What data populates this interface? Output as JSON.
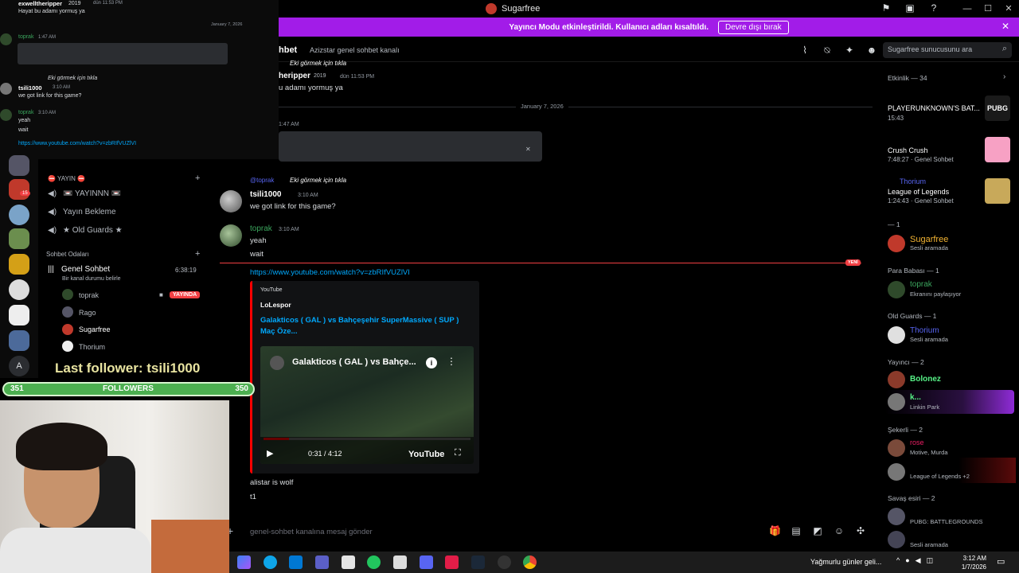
{
  "window": {
    "title": "Sugarfree"
  },
  "banner": {
    "message": "Yayıncı Modu etkinleştirildi. Kullanıcı adları kısaltıldı.",
    "button": "Devre dışı bırak"
  },
  "channel": {
    "name": "hbet",
    "topic": "Azizstar genel sohbet kanalı",
    "search_placeholder": "Sugarfree sunucusunu ara"
  },
  "chat": {
    "top_msg": {
      "title": "Eki görmek için tıkla",
      "name": "heripper",
      "badge": "2019",
      "time": "dün 11:53 PM",
      "text": "u adamı yormuş ya"
    },
    "date": "January 7, 2026",
    "msg2_time": "1:47 AM",
    "reply_ref": {
      "who": "@toprak",
      "text": "Eki görmek için tıkla"
    },
    "msg3": {
      "name": "tsili1000",
      "time": "3:10 AM",
      "text": "we got link  for this game?"
    },
    "msg4": {
      "name": "toprak",
      "time": "3:10 AM",
      "lines": [
        "yeah",
        "wait"
      ]
    },
    "new_badge": "YENİ",
    "link": "https://www.youtube.com/watch?v=zbRIfVUZlVI",
    "embed": {
      "provider": "YouTube",
      "author": "LoLespor",
      "title": "Galakticos  ( GAL ) vs Bahçeşehir SuperMassive  ( SUP ) Maç Öze...",
      "video_title": "Galakticos ( GAL ) vs Bahçe...",
      "time": "0:31 / 4:12",
      "progress": 0.123,
      "yt_label": "YouTube"
    },
    "msg5_lines": [
      "alistar is wolf",
      "t1"
    ]
  },
  "composer": {
    "placeholder": "genel-sohbet kanalına mesaj gönder"
  },
  "members": {
    "activity_header": "Etkinlik — 34",
    "activities": [
      {
        "title": "PLAYERUNKNOWN'S BAT...",
        "sub": "15:43",
        "thumb": "PUBG"
      },
      {
        "title": "Crush Crush",
        "sub": "7:48:27 · Genel Sohbet"
      },
      {
        "name": "Thorium",
        "title": "League of Legends",
        "sub": "1:24:43 · Genel Sohbet"
      }
    ],
    "groups": [
      {
        "header": "— 1",
        "members": [
          {
            "name": "Sugarfree",
            "sub": "Sesli aramada",
            "color": "#f0b232"
          }
        ]
      },
      {
        "header": "Para Babası — 1",
        "members": [
          {
            "name": "toprak",
            "sub": "Ekranını paylaşıyor",
            "color": "#3ba55d"
          }
        ]
      },
      {
        "header": "Old Guards — 1",
        "members": [
          {
            "name": "Thorium",
            "sub": "Sesli aramada",
            "color": "#5865f2"
          }
        ]
      },
      {
        "header": "Yayıncı — 2",
        "members": [
          {
            "name": "Bolonez",
            "sub": "",
            "color": "#57f287"
          },
          {
            "name": "k...",
            "sub": "Linkin Park",
            "color": "#57f287"
          }
        ]
      },
      {
        "header": "Şekerli — 2",
        "members": [
          {
            "name": "rose",
            "sub": "Motive, Murda",
            "color": "#e91e63"
          },
          {
            "name": "",
            "sub": "League of Legends +2",
            "color": "#ffffff"
          }
        ]
      },
      {
        "header": "Savaş esiri — 2",
        "members": [
          {
            "name": "",
            "sub": "PUBG: BATTLEGROUNDS",
            "color": "#ffffff"
          },
          {
            "name": "",
            "sub": "Sesli aramada",
            "color": "#ffffff"
          }
        ]
      }
    ]
  },
  "overlay": {
    "chat_top": {
      "name": "exwelltheripper",
      "badge": "2019",
      "time": "dün 11:53 PM",
      "text": "Hayat bu adamı yormuş ya"
    },
    "date": "January 7, 2026",
    "msg2": {
      "name": "toprak",
      "time": "1:47 AM"
    },
    "reply": "Eki görmek için tıkla",
    "msg3": {
      "name": "tsili1000",
      "time": "3:10 AM",
      "text": "we got link  for this game?"
    },
    "msg4": {
      "name": "toprak",
      "time": "3:10 AM",
      "lines": [
        "yeah",
        "wait"
      ]
    },
    "link": "https://www.youtube.com/watch?v=zbRIfVUZlVI",
    "channels": {
      "live_cat": "⛔ YAYIN ⛔",
      "items": [
        "📼 YAYINNN 📼",
        "Yayın Bekleme",
        "★ Old Guards ★"
      ],
      "cat2": "Sohbet Odaları",
      "voice": {
        "name": "Genel Sohbet",
        "status": "Bir kanal durumu belirle",
        "timer": "6:38:19"
      },
      "voice_members": [
        "toprak",
        "Rago",
        "Sugarfree",
        "Thorium"
      ],
      "live": "YAYINDA"
    },
    "follower": {
      "last": "Last follower: tsili1000",
      "left": "351",
      "center": "FOLLOWERS",
      "right": "350"
    },
    "guild_badge": "15"
  },
  "taskbar": {
    "weather": "Yağmurlu günler geli...",
    "time": "3:12 AM",
    "date": "1/7/2026"
  }
}
